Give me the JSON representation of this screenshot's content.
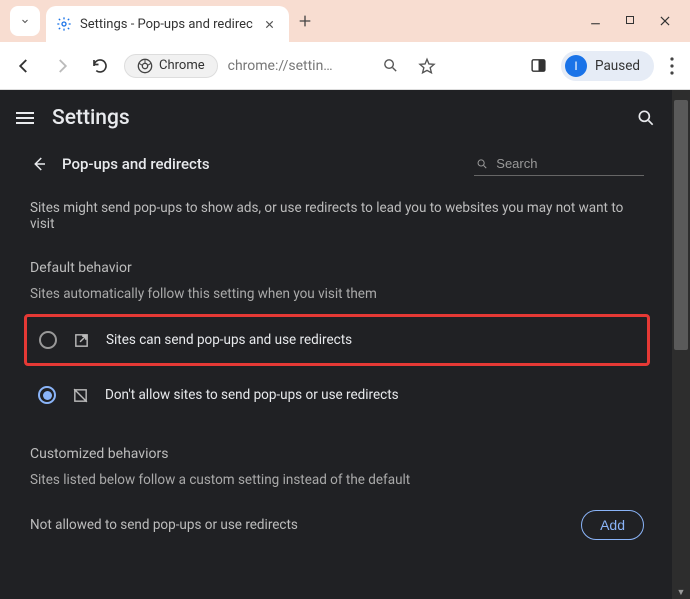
{
  "tab": {
    "title": "Settings - Pop-ups and redirec"
  },
  "omnibox": {
    "pill_label": "Chrome",
    "url": "chrome://settin…"
  },
  "profile": {
    "initial": "I",
    "status": "Paused"
  },
  "header": {
    "title": "Settings"
  },
  "subheader": {
    "title": "Pop-ups and redirects",
    "search_placeholder": "Search"
  },
  "description": "Sites might send pop-ups to show ads, or use redirects to lead you to websites you may not want to visit",
  "default_behavior": {
    "title": "Default behavior",
    "subtitle": "Sites automatically follow this setting when you visit them",
    "options": [
      {
        "label": "Sites can send pop-ups and use redirects",
        "selected": false
      },
      {
        "label": "Don't allow sites to send pop-ups or use redirects",
        "selected": true
      }
    ]
  },
  "customized": {
    "title": "Customized behaviors",
    "subtitle": "Sites listed below follow a custom setting instead of the default",
    "not_allowed_label": "Not allowed to send pop-ups or use redirects",
    "add_button": "Add"
  }
}
